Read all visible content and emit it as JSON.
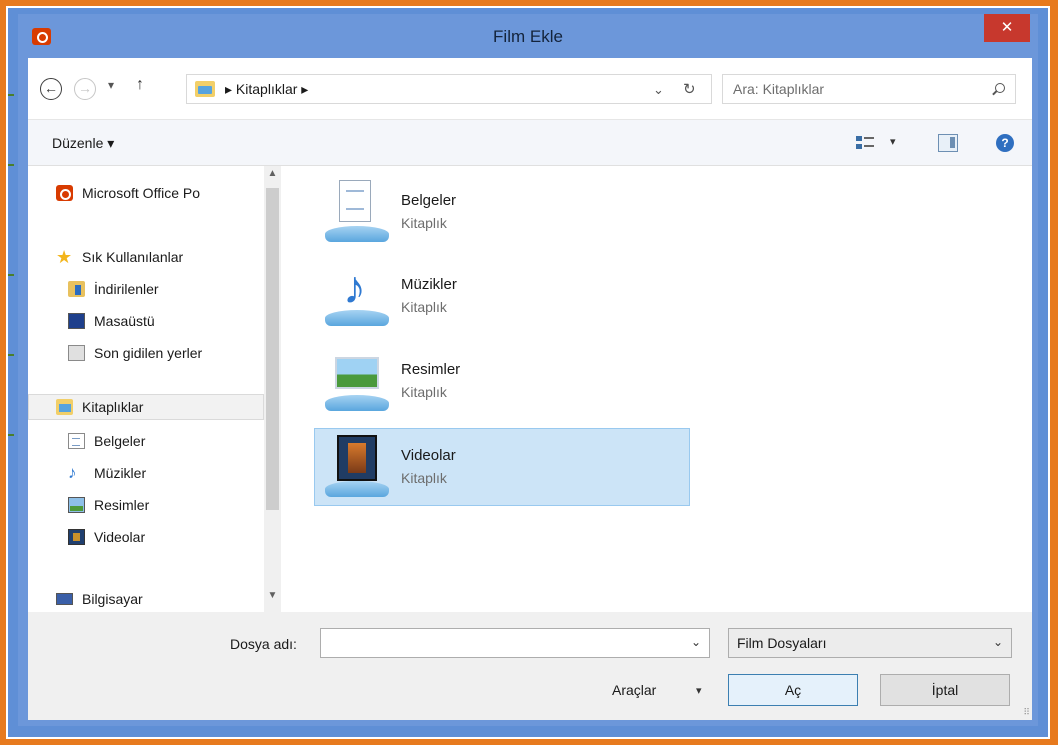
{
  "window": {
    "title": "Film Ekle",
    "close_symbol": "✕"
  },
  "nav": {
    "back_symbol": "←",
    "forward_symbol": "→",
    "recent_symbol": "▾",
    "up_symbol": "↑",
    "breadcrumb_text": "▸ Kitaplıklar ▸",
    "dropdown_symbol": "⌄",
    "refresh_symbol": "↻"
  },
  "search": {
    "placeholder": "Ara: Kitaplıklar"
  },
  "toolbar": {
    "organize_label": "Düzenle ▾",
    "view_caret": "▾",
    "help_symbol": "?"
  },
  "sidebar": {
    "items": [
      {
        "label": "Microsoft Office Po",
        "icon": "office-icon"
      },
      {
        "label": "Sık Kullanılanlar",
        "icon": "star-icon"
      },
      {
        "label": "İndirilenler",
        "icon": "downloads-icon"
      },
      {
        "label": "Masaüstü",
        "icon": "desktop-icon"
      },
      {
        "label": "Son gidilen yerler",
        "icon": "recent-places-icon"
      },
      {
        "label": "Kitaplıklar",
        "icon": "libraries-icon"
      },
      {
        "label": "Belgeler",
        "icon": "documents-icon"
      },
      {
        "label": "Müzikler",
        "icon": "music-icon"
      },
      {
        "label": "Resimler",
        "icon": "pictures-icon"
      },
      {
        "label": "Videolar",
        "icon": "videos-icon"
      },
      {
        "label": "Bilgisayar",
        "icon": "computer-icon"
      }
    ],
    "scroll_up": "▲",
    "scroll_down": "▼"
  },
  "libraries": [
    {
      "name": "Belgeler",
      "type": "Kitaplık"
    },
    {
      "name": "Müzikler",
      "type": "Kitaplık"
    },
    {
      "name": "Resimler",
      "type": "Kitaplık"
    },
    {
      "name": "Videolar",
      "type": "Kitaplık"
    }
  ],
  "bottom": {
    "filename_label": "Dosya adı:",
    "filename_value": "",
    "combo_caret": "⌄",
    "filter_value": "Film Dosyaları",
    "tools_label": "Araçlar",
    "tools_caret": "▾",
    "open_label": "Aç",
    "cancel_label": "İptal",
    "grip": "⠿"
  }
}
